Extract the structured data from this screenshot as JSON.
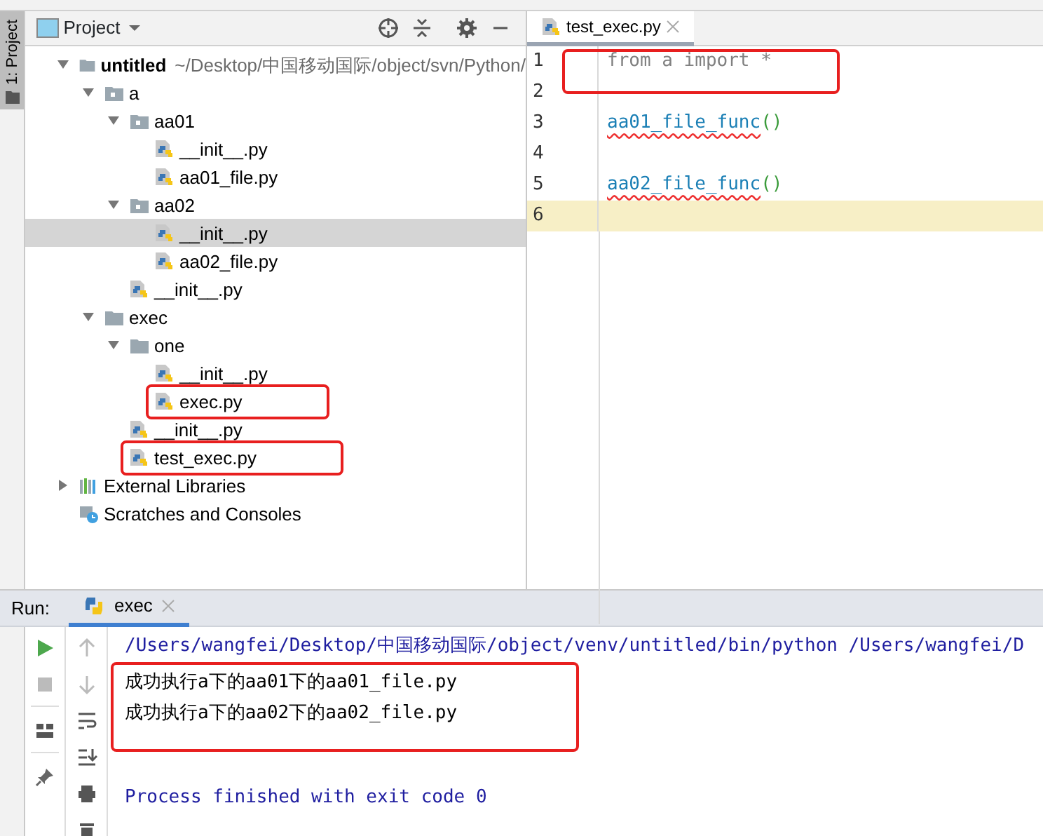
{
  "side_strip": {
    "label": "1: Project"
  },
  "project_panel": {
    "title": "Project",
    "tree": [
      {
        "name": "untitled",
        "detail": "~/Desktop/中国移动国际/object/svn/Python/",
        "kind": "root",
        "expanded": true,
        "selected": false,
        "annotated": false,
        "children": [
          {
            "name": "a",
            "kind": "package",
            "expanded": true,
            "selected": false,
            "annotated": false,
            "children": [
              {
                "name": "aa01",
                "kind": "package",
                "expanded": true,
                "selected": false,
                "annotated": false,
                "children": [
                  {
                    "name": "__init__.py",
                    "kind": "python",
                    "selected": false,
                    "annotated": false
                  },
                  {
                    "name": "aa01_file.py",
                    "kind": "python",
                    "selected": false,
                    "annotated": false
                  }
                ]
              },
              {
                "name": "aa02",
                "kind": "package",
                "expanded": true,
                "selected": false,
                "annotated": false,
                "children": [
                  {
                    "name": "__init__.py",
                    "kind": "python",
                    "selected": true,
                    "annotated": false
                  },
                  {
                    "name": "aa02_file.py",
                    "kind": "python",
                    "selected": false,
                    "annotated": false
                  }
                ]
              },
              {
                "name": "__init__.py",
                "kind": "python",
                "selected": false,
                "annotated": false
              }
            ]
          },
          {
            "name": "exec",
            "kind": "folder",
            "expanded": true,
            "selected": false,
            "annotated": false,
            "children": [
              {
                "name": "one",
                "kind": "folder",
                "expanded": true,
                "selected": false,
                "annotated": false,
                "children": [
                  {
                    "name": "__init__.py",
                    "kind": "python",
                    "selected": false,
                    "annotated": false
                  },
                  {
                    "name": "exec.py",
                    "kind": "python",
                    "selected": false,
                    "annotated": true
                  }
                ]
              },
              {
                "name": "__init__.py",
                "kind": "python",
                "selected": false,
                "annotated": false
              },
              {
                "name": "test_exec.py",
                "kind": "python",
                "selected": false,
                "annotated": true
              }
            ]
          }
        ]
      },
      {
        "name": "External Libraries",
        "kind": "libraries",
        "expanded": false,
        "selected": false,
        "annotated": false
      },
      {
        "name": "Scratches and Consoles",
        "kind": "scratches",
        "selected": false,
        "annotated": false
      }
    ]
  },
  "editor": {
    "tabs": [
      {
        "label": "test_exec.py",
        "selected": true
      }
    ],
    "lines": [
      {
        "number": "1",
        "current": false,
        "annotated": true,
        "tokens": [
          {
            "text": "from a import *",
            "kind": "unused"
          }
        ]
      },
      {
        "number": "2",
        "current": false,
        "annotated": false
      },
      {
        "number": "3",
        "current": false,
        "annotated": false,
        "tokens": [
          {
            "text": "aa01_file_func",
            "kind": "unresolved"
          },
          {
            "text": "()",
            "kind": "paren"
          }
        ]
      },
      {
        "number": "4",
        "current": false,
        "annotated": false
      },
      {
        "number": "5",
        "current": false,
        "annotated": false,
        "tokens": [
          {
            "text": "aa02_file_func",
            "kind": "unresolved"
          },
          {
            "text": "()",
            "kind": "paren"
          }
        ]
      },
      {
        "number": "6",
        "current": true,
        "annotated": false
      }
    ]
  },
  "run_panel": {
    "label": "Run:",
    "tabs": [
      {
        "label": "exec",
        "selected": true
      }
    ],
    "console": [
      {
        "text": "/Users/wangfei/Desktop/中国移动国际/object/venv/untitled/bin/python /Users/wangfei/D",
        "kind": "command",
        "annotated": false
      },
      {
        "text": "成功执行a下的aa01下的aa01_file.py",
        "kind": "output",
        "annotated": true
      },
      {
        "text": "成功执行a下的aa02下的aa02_file.py",
        "kind": "output",
        "annotated": true
      },
      {
        "text": "Process finished with exit code 0",
        "kind": "status",
        "annotated": false
      }
    ]
  }
}
